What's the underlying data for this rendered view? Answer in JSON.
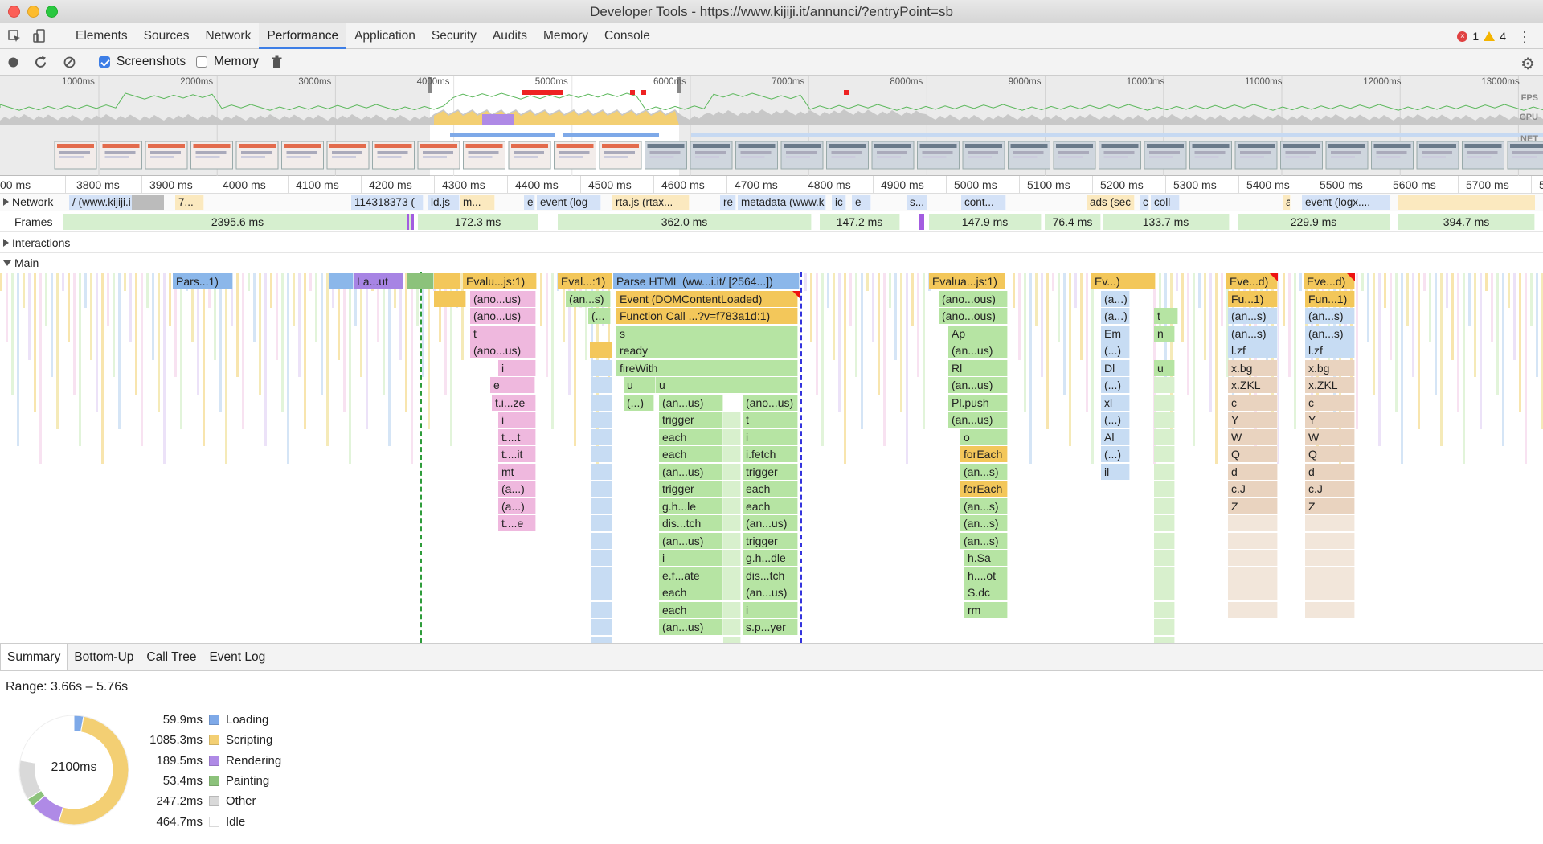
{
  "window": {
    "title": "Developer Tools - https://www.kijiji.it/annunci/?entryPoint=sb"
  },
  "tabs": [
    {
      "label": "Elements"
    },
    {
      "label": "Sources"
    },
    {
      "label": "Network"
    },
    {
      "label": "Performance"
    },
    {
      "label": "Application"
    },
    {
      "label": "Security"
    },
    {
      "label": "Audits"
    },
    {
      "label": "Memory"
    },
    {
      "label": "Console"
    }
  ],
  "active_tab": "Performance",
  "status": {
    "errors": "1",
    "warnings": "4"
  },
  "perf_toolbar": {
    "screenshots_label": "Screenshots",
    "screenshots_checked": true,
    "memory_label": "Memory",
    "memory_checked": false
  },
  "overview": {
    "ticks": [
      "1000ms",
      "2000ms",
      "3000ms",
      "4000ms",
      "5000ms",
      "6000ms",
      "7000ms",
      "8000ms",
      "9000ms",
      "10000ms",
      "11000ms",
      "12000ms",
      "13000ms"
    ],
    "labels": {
      "fps": "FPS",
      "cpu": "CPU",
      "net": "NET"
    }
  },
  "ruler": {
    "ticks": [
      "00 ms",
      "3800 ms",
      "3900 ms",
      "4000 ms",
      "4100 ms",
      "4200 ms",
      "4300 ms",
      "4400 ms",
      "4500 ms",
      "4600 ms",
      "4700 ms",
      "4800 ms",
      "4900 ms",
      "5000 ms",
      "5100 ms",
      "5200 ms",
      "5300 ms",
      "5400 ms",
      "5500 ms",
      "5600 ms",
      "5700 ms",
      "580"
    ]
  },
  "tracks": {
    "network": {
      "label": "Network",
      "items": [
        "/ (www.kijiji.i...",
        "7...",
        "114318373 (",
        "ld.js",
        "m...",
        "e",
        "event (log",
        "rta.js (rtax...",
        "re",
        "metadata (www.k",
        "ic",
        "e",
        "s...",
        "cont...",
        "ads (sec",
        "c",
        "coll",
        "a",
        "event (logx...."
      ]
    },
    "frames": {
      "label": "Frames",
      "items": [
        "2395.6 ms",
        "172.3 ms",
        "362.0 ms",
        "147.2 ms",
        "147.9 ms",
        "76.4 ms",
        "133.7 ms",
        "229.9 ms",
        "394.7 ms"
      ]
    },
    "interactions": {
      "label": "Interactions"
    },
    "main": {
      "label": "Main"
    }
  },
  "flame": {
    "row0": [
      "Pars...1)",
      "La...ut",
      "Evalu...js:1)",
      "Eval...:1)",
      "Parse HTML (ww...i.it/ [2564...])",
      "Evalua...js:1)",
      "Ev...)",
      "Eve...d)",
      "Eve...d)"
    ],
    "col_a": [
      "(ano...us)",
      "(ano...us)",
      "t",
      "(ano...us)",
      "i",
      "e",
      "t.i...ze",
      "i",
      "t....t",
      "t....it",
      "mt",
      "(a...)",
      "(a...)",
      "t....e"
    ],
    "col_b1": [
      "(an...s)",
      "(..."
    ],
    "col_c_top": [
      "Event (DOMContentLoaded)",
      "Function Call ...?v=f783a1d:1)",
      "s",
      "ready",
      "fireWith"
    ],
    "col_c_uu": [
      "u",
      "u"
    ],
    "col_c_left": [
      "(...)",
      "(an...us)",
      "trigger",
      "each",
      "each",
      "(an...us)",
      "trigger",
      "g.h...le",
      "dis...tch",
      "(an...us)",
      "i",
      "e.f...ate",
      "each",
      "each",
      "(an...us)"
    ],
    "col_c_right": [
      "(ano...us)",
      "t",
      "i",
      "i.fetch",
      "trigger",
      "each",
      "each",
      "(an...us)",
      "trigger",
      "g.h...dle",
      "dis...tch",
      "(an...us)",
      "i",
      "s.p...yer"
    ],
    "col_d": [
      "(ano...ous)",
      "(ano...ous)",
      "Ap",
      "(an...us)",
      "Rl",
      "(an...us)",
      "Pl.push",
      "(an...us)",
      "o",
      "forEach",
      "(an...s)",
      "forEach",
      "(an...s)",
      "(an...s)",
      "(an...s)",
      "h.Sa",
      "h....ot",
      "S.dc",
      "rm"
    ],
    "col_e": [
      "(a...)",
      "(a...)",
      "Em",
      "(...)",
      "Dl",
      "(...)",
      "xl",
      "(...)",
      "Al",
      "(...)",
      "il"
    ],
    "col_e2": [
      "t",
      "n",
      "u"
    ],
    "col_f": [
      "Fu...1)",
      "(an...s)",
      "(an...s)",
      "l.zf",
      "x.bg",
      "x.ZKL",
      "c",
      "Y",
      "W",
      "Q",
      "d",
      "c.J",
      "Z"
    ],
    "col_g": [
      "Fun...1)",
      "(an...s)",
      "(an...s)",
      "l.zf",
      "x.bg",
      "x.ZKL",
      "c",
      "Y",
      "W",
      "Q",
      "d",
      "c.J",
      "Z"
    ]
  },
  "bottom": {
    "tabs": [
      "Summary",
      "Bottom-Up",
      "Call Tree",
      "Event Log"
    ],
    "active": "Summary",
    "range": "Range: 3.66s – 5.76s",
    "total": "2100ms",
    "legend": [
      {
        "value": "59.9ms",
        "label": "Loading",
        "color": "#7ea9e8"
      },
      {
        "value": "1085.3ms",
        "label": "Scripting",
        "color": "#f3cf73"
      },
      {
        "value": "189.5ms",
        "label": "Rendering",
        "color": "#af8ae6"
      },
      {
        "value": "53.4ms",
        "label": "Painting",
        "color": "#8cc27b"
      },
      {
        "value": "247.2ms",
        "label": "Other",
        "color": "#d9d9d9"
      },
      {
        "value": "464.7ms",
        "label": "Idle",
        "color": "#ffffff"
      }
    ]
  }
}
